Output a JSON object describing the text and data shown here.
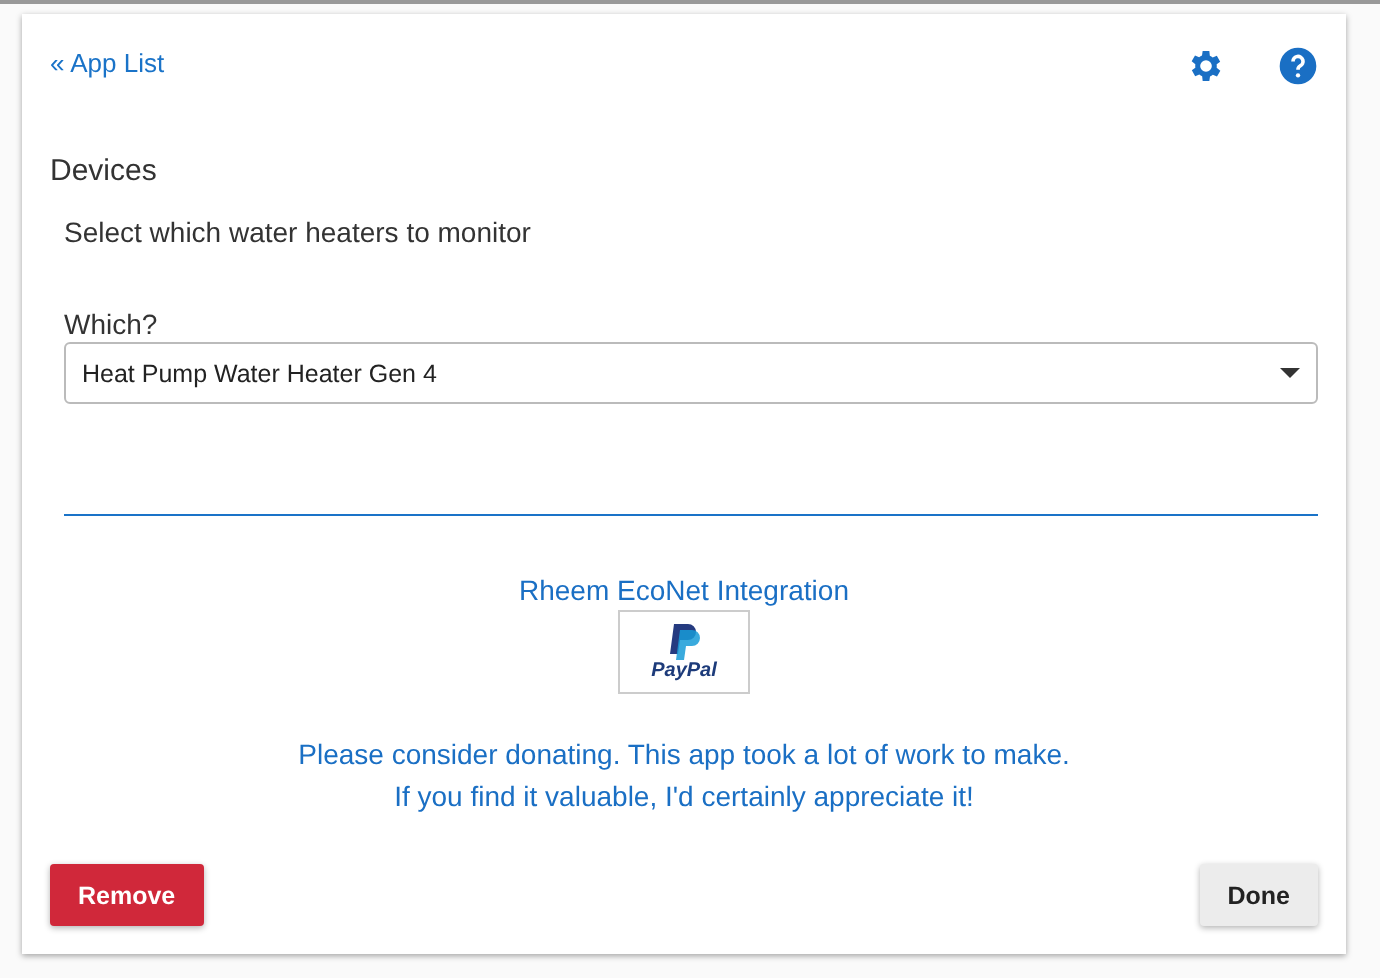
{
  "back_link": "« App List",
  "section": {
    "title": "Devices",
    "description": "Select which water heaters to monitor"
  },
  "select": {
    "label": "Which?",
    "value": "Heat Pump Water Heater Gen 4"
  },
  "app_name": "Rheem EcoNet Integration",
  "donate_logo": "PayPal",
  "donate_text": [
    "Please consider donating. This app took a lot of work to make.",
    "If you find it valuable, I'd certainly appreciate it!"
  ],
  "buttons": [
    {
      "label": "Remove",
      "kind": "danger"
    },
    {
      "label": "Done",
      "kind": "plain"
    }
  ]
}
